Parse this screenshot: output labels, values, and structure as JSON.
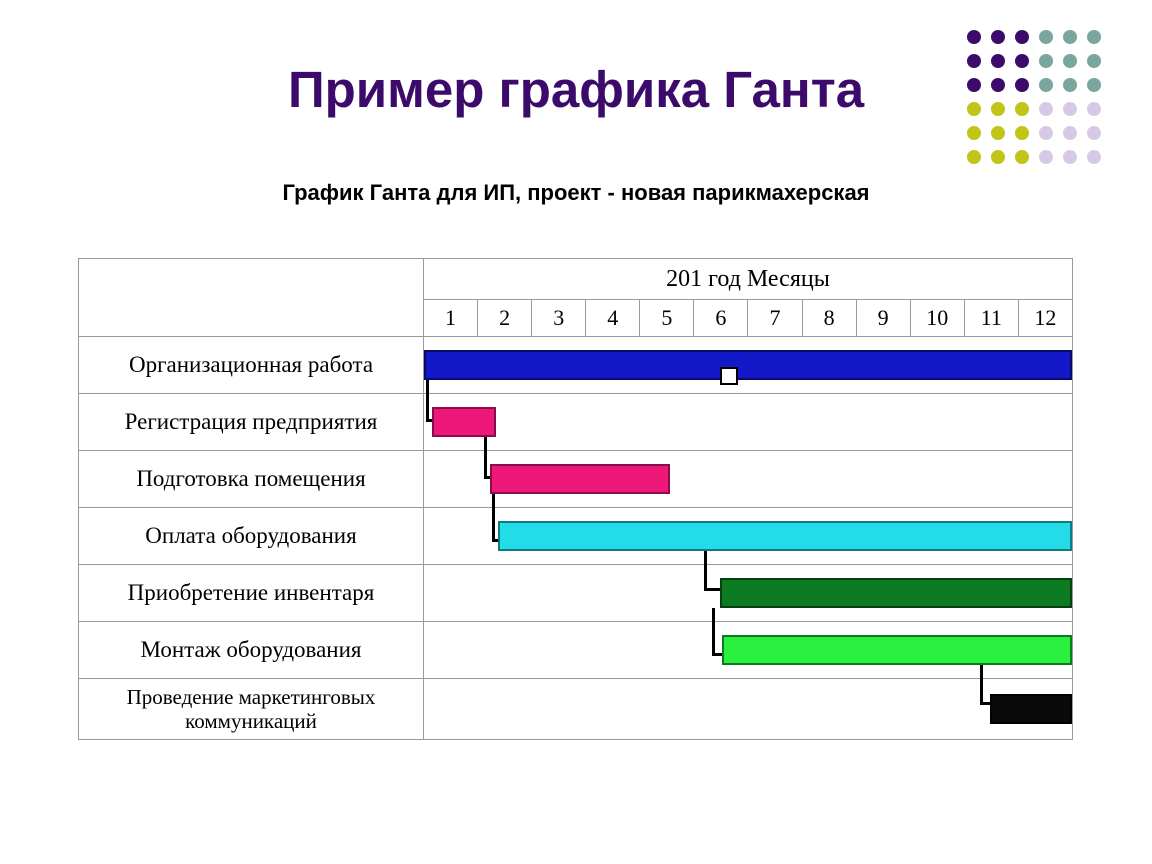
{
  "slide_title": "Пример графика Ганта",
  "subtitle": "График Ганта для ИП, проект - новая парикмахерская",
  "chart_data": {
    "type": "bar",
    "time_header": "201   год Месяцы",
    "categories": [
      1,
      2,
      3,
      4,
      5,
      6,
      7,
      8,
      9,
      10,
      11,
      12
    ],
    "series": [
      {
        "name": "Организационная работа",
        "start": 1,
        "end": 12,
        "color": "#1318c8"
      },
      {
        "name": "Регистрация предприятия",
        "start": 1,
        "end": 2,
        "color": "#ed187a"
      },
      {
        "name": "Подготовка помещения",
        "start": 2,
        "end": 5,
        "color": "#ed187a"
      },
      {
        "name": "Оплата оборудования",
        "start": 2,
        "end": 12,
        "color": "#22dde7"
      },
      {
        "name": "Приобретение инвентаря",
        "start": 6,
        "end": 12,
        "color": "#0c7a20"
      },
      {
        "name": "Монтаж оборудования",
        "start": 6,
        "end": 12,
        "color": "#2af03f"
      },
      {
        "name": "Проведение маркетинговых коммуникаций",
        "start": 11,
        "end": 12,
        "color": "#0a0a0a"
      }
    ],
    "xlabel": "Месяцы",
    "ylabel": "",
    "xlim": [
      1,
      12
    ]
  },
  "decor_dots": {
    "colors": {
      "purple": "#3b0a6b",
      "teal": "#7aa6a0",
      "olive": "#c0c517",
      "lav": "#d7c9e6"
    }
  }
}
